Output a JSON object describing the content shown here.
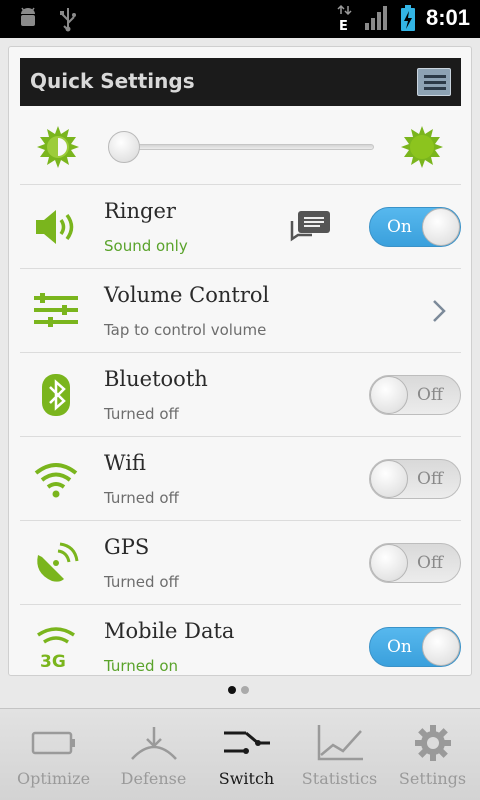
{
  "status_bar": {
    "time": "8:01",
    "network_type": "E",
    "icons": [
      "android-debug-icon",
      "usb-icon",
      "data-e-icon",
      "signal-icon",
      "battery-charging-icon"
    ]
  },
  "quick_settings": {
    "title": "Quick Settings",
    "menu_icon": "list-menu-icon",
    "brightness": {
      "min_icon": "brightness-low-icon",
      "max_icon": "brightness-high-icon",
      "level": 0.0
    },
    "rows": [
      {
        "title": "Ringer",
        "subtitle": "Sound only",
        "control": "toggle",
        "state": "On",
        "icon": "speaker-icon"
      },
      {
        "title": "Volume Control",
        "subtitle": "Tap to control volume",
        "control": "chevron",
        "icon": "equalizer-sliders-icon"
      },
      {
        "title": "Bluetooth",
        "subtitle": "Turned off",
        "control": "toggle",
        "state": "Off",
        "icon": "bluetooth-icon"
      },
      {
        "title": "Wifi",
        "subtitle": "Turned off",
        "control": "toggle",
        "state": "Off",
        "icon": "wifi-icon"
      },
      {
        "title": "GPS",
        "subtitle": "Turned off",
        "control": "toggle",
        "state": "Off",
        "icon": "gps-satellite-icon"
      },
      {
        "title": "Mobile Data",
        "subtitle": "Turned on",
        "control": "toggle",
        "state": "On",
        "icon": "mobile-data-3g-icon"
      }
    ]
  },
  "pager": {
    "pages": 2,
    "current": 1
  },
  "bottom_nav": [
    {
      "label": "Optimize",
      "icon": "battery-outline-icon",
      "active": false
    },
    {
      "label": "Defense",
      "icon": "defense-arrow-icon",
      "active": false
    },
    {
      "label": "Switch",
      "icon": "switch-icon",
      "active": true
    },
    {
      "label": "Statistics",
      "icon": "line-chart-icon",
      "active": false
    },
    {
      "label": "Settings",
      "icon": "gear-icon",
      "active": false
    }
  ],
  "colors": {
    "accent_green": "#7ab51d",
    "toggle_on": "#4bb0e8",
    "header_bg": "#1b1b1b"
  }
}
